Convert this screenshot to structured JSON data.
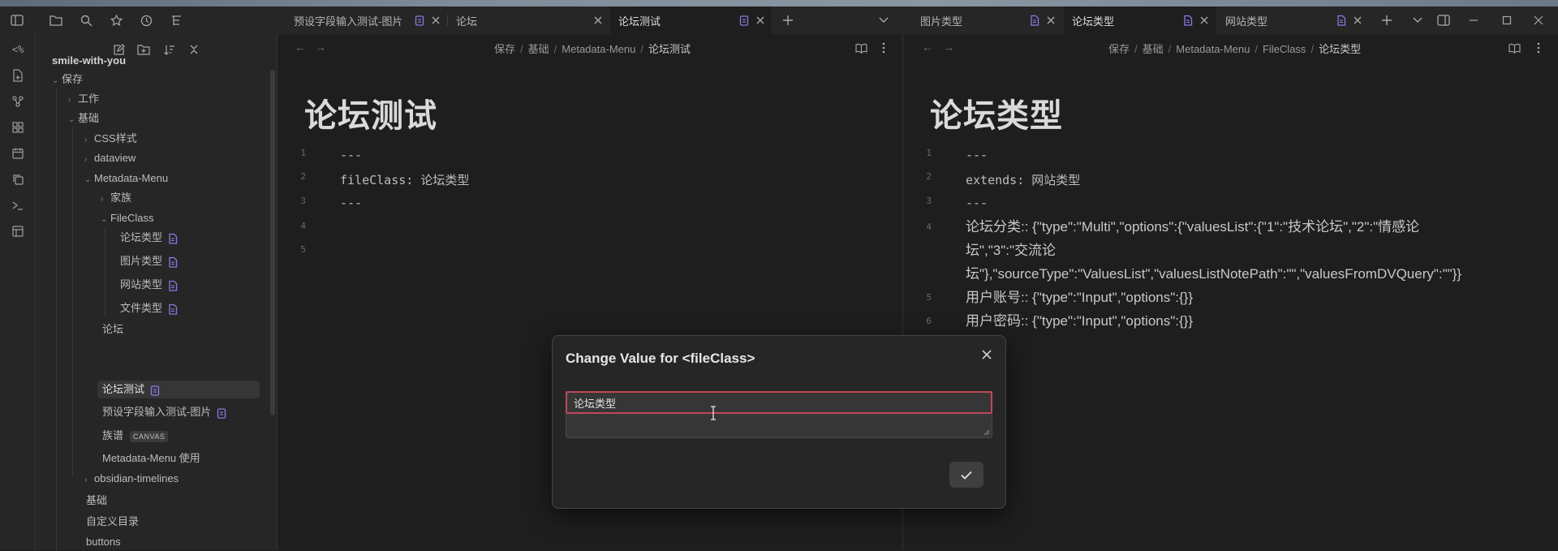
{
  "tabs_left": [
    {
      "label": "预设字段输入测试-图片",
      "active": false
    },
    {
      "label": "论坛",
      "active": false
    },
    {
      "label": "论坛测试",
      "active": true
    }
  ],
  "tabs_right": [
    {
      "label": "图片类型",
      "active": false
    },
    {
      "label": "论坛类型",
      "active": true
    },
    {
      "label": "网站类型",
      "active": false
    }
  ],
  "sidebar": {
    "vault_name": "smile-with-you",
    "items": [
      {
        "label": "保存"
      },
      {
        "label": "工作"
      },
      {
        "label": "基础"
      },
      {
        "label": "CSS样式"
      },
      {
        "label": "dataview"
      },
      {
        "label": "Metadata-Menu"
      },
      {
        "label": "家族"
      },
      {
        "label": "FileClass"
      },
      {
        "label": "论坛类型"
      },
      {
        "label": "图片类型"
      },
      {
        "label": "网站类型"
      },
      {
        "label": "文件类型"
      },
      {
        "label": "论坛"
      },
      {
        "label": "论坛测试"
      },
      {
        "label": "预设字段输入测试-图片"
      },
      {
        "label": "族谱",
        "badge": "CANVAS"
      },
      {
        "label": "Metadata-Menu 使用"
      },
      {
        "label": "obsidian-timelines"
      },
      {
        "label": "基础"
      },
      {
        "label": "自定义目录"
      },
      {
        "label": "buttons"
      }
    ]
  },
  "left_pane": {
    "breadcrumb": [
      "保存",
      "基础",
      "Metadata-Menu",
      "论坛测试"
    ],
    "title": "论坛测试",
    "lines": [
      {
        "no": "1",
        "text": "---"
      },
      {
        "no": "2",
        "text": "fileClass: 论坛类型"
      },
      {
        "no": "3",
        "text": "---"
      },
      {
        "no": "4",
        "text": ""
      },
      {
        "no": "5",
        "text": ""
      }
    ]
  },
  "right_pane": {
    "breadcrumb": [
      "保存",
      "基础",
      "Metadata-Menu",
      "FileClass",
      "论坛类型"
    ],
    "title": "论坛类型",
    "lines": [
      {
        "no": "1",
        "text": "---"
      },
      {
        "no": "2",
        "text": "extends: 网站类型"
      },
      {
        "no": "3",
        "text": "---"
      },
      {
        "no": "4",
        "text": "论坛分类:: {\"type\":\"Multi\",\"options\":{\"valuesList\":{\"1\":\"技术论坛\",\"2\":\"情感论坛\",\"3\":\"交流论坛\"},\"sourceType\":\"ValuesList\",\"valuesListNotePath\":\"\",\"valuesFromDVQuery\":\"\"}}"
      },
      {
        "no": "5",
        "text": "用户账号:: {\"type\":\"Input\",\"options\":{}}"
      },
      {
        "no": "6",
        "text": "用户密码:: {\"type\":\"Input\",\"options\":{}}"
      }
    ],
    "line4_wrapped": [
      "论坛分类:: {\"type\":\"Multi\",\"options\":{\"valuesList\":{\"1\":\"技术论坛\",\"2\":\"情感论",
      "坛\",\"3\":\"交流论",
      "坛\"},\"sourceType\":\"ValuesList\",\"valuesListNotePath\":\"\",\"valuesFromDVQuery\":\"\"}}"
    ]
  },
  "modal": {
    "title": "Change Value for <fileClass>",
    "input_value": "论坛类型"
  },
  "colors": {
    "background": "#1e1e1e",
    "panel": "#262626",
    "accent_doc_icon": "#7a6ad8",
    "input_border": "#c0485a"
  }
}
